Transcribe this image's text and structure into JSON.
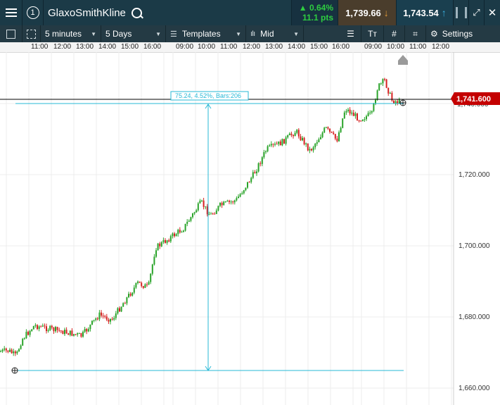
{
  "header": {
    "instrument": "GlaxoSmithKline",
    "workspace_number": "1",
    "change_pct": "▲ 0.64%",
    "change_pts": "11.1 pts",
    "sell_price": "1,739.66",
    "buy_price": "1,743.54"
  },
  "toolbar": {
    "interval": "5 minutes",
    "range": "5 Days",
    "templates": "Templates",
    "price_type": "Mid",
    "settings": "Settings"
  },
  "time_axis": [
    "11:00",
    "12:00",
    "13:00",
    "14:00",
    "15:00",
    "16:00",
    "09:00",
    "10:00",
    "11:00",
    "12:00",
    "13:00",
    "14:00",
    "15:00",
    "16:00",
    "09:00",
    "10:00",
    "11:00",
    "12:00"
  ],
  "price_axis": [
    "1,720.000",
    "1,700.000",
    "1,680.000",
    "1,660.000"
  ],
  "current_price": "1,741.600",
  "measure_label": "75.24, 4.52%, Bars:206",
  "colors": {
    "up": "#29a329",
    "down": "#d62020",
    "measure": "#27b8d6",
    "price_tag": "#c40000"
  },
  "chart_data": {
    "type": "candlestick",
    "y_ticks": [
      1720,
      1700,
      1680,
      1660
    ],
    "last": 1741.6,
    "measure_from": 1666.36,
    "measure_to": 1741.6
  }
}
